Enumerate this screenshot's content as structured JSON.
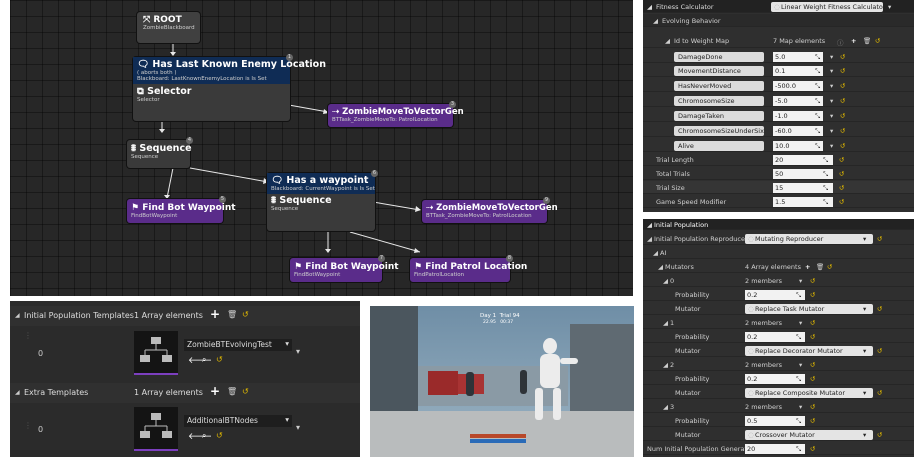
{
  "bt": {
    "root": {
      "title": "ROOT",
      "sub": "ZombieBlackboard"
    },
    "selector_node": {
      "deco_title": "Has Last Known Enemy Location",
      "deco_l1": "( aborts both )",
      "deco_l2": "Blackboard: LastKnownEnemyLocation is Is Set",
      "title": "Selector",
      "sub": "Selector",
      "pin": "1"
    },
    "move1": {
      "title": "ZombieMoveToVectorGen",
      "sub": "BTTask_ZombieMoveTo: PatrolLocation",
      "pin": "3"
    },
    "sequence1": {
      "title": "Sequence",
      "sub": "Sequence",
      "pin": "4"
    },
    "find1": {
      "title": "Find Bot Waypoint",
      "sub": "FindBotWaypoint",
      "pin": "5"
    },
    "sequence2": {
      "deco_title": "Has a waypoint",
      "deco_l1": "Blackboard: CurrentWaypoint is Is Set",
      "title": "Sequence",
      "sub": "Sequence",
      "pin": "6"
    },
    "move2": {
      "title": "ZombieMoveToVectorGen",
      "sub": "BTTask_ZombieMoveTo: PatrolLocation",
      "pin": "9"
    },
    "find2": {
      "title": "Find Bot Waypoint",
      "sub": "FindBotWaypoint",
      "pin": "7"
    },
    "find3": {
      "title": "Find Patrol Location",
      "sub": "FindPatrolLocation",
      "pin": "8"
    },
    "pin_sel_small": "1",
    "pin_move1_small": "3"
  },
  "fitness": {
    "label": "Fitness Calculator",
    "value": "Linear Weight Fitness Calculator",
    "evolving": "Evolving Behavior",
    "map_label": "Id to Weight Map",
    "map_count": "7 Map elements",
    "entries": [
      {
        "key": "DamageDone",
        "val": "5.0"
      },
      {
        "key": "MovementDistance",
        "val": "0.1"
      },
      {
        "key": "HasNeverMoved",
        "val": "-500.0"
      },
      {
        "key": "ChromosomeSize",
        "val": "-5.0"
      },
      {
        "key": "DamageTaken",
        "val": "-1.0"
      },
      {
        "key": "ChromosomeSizeUnderSix",
        "val": "-60.0"
      },
      {
        "key": "Alive",
        "val": "10.0"
      }
    ],
    "params": [
      {
        "label": "Trial Length",
        "val": "20"
      },
      {
        "label": "Total Trials",
        "val": "50"
      },
      {
        "label": "Trial Size",
        "val": "15"
      },
      {
        "label": "Game Speed Modifier",
        "val": "1.5"
      }
    ]
  },
  "population": {
    "header": "Initial Population",
    "repro_label": "Initial Population Reproducer",
    "repro_val": "Mutating Reproducer",
    "ai": "AI",
    "mutators_label": "Mutators",
    "mutators_count": "4 Array elements",
    "items": [
      {
        "idx": "0",
        "members": "2 members",
        "prob": "0.2",
        "mutator": "Replace Task Mutator"
      },
      {
        "idx": "1",
        "members": "2 members",
        "prob": "0.2",
        "mutator": "Replace Decorator Mutator"
      },
      {
        "idx": "2",
        "members": "2 members",
        "prob": "0.2",
        "mutator": "Replace Composite Mutator"
      },
      {
        "idx": "3",
        "members": "2 members",
        "prob": "0.5",
        "mutator": "Crossover Mutator"
      }
    ],
    "prob_label": "Probability",
    "mutator_label": "Mutator",
    "num_label": "Num Initial Population Generatio",
    "num_val": "20"
  },
  "templates": {
    "t1_label": "Initial Population Templates",
    "t1_count": "1 Array elements",
    "t1_idx": "0",
    "t1_val": "ZombieBTEvolvingTest",
    "t2_label": "Extra Templates",
    "t2_count": "1 Array elements",
    "t2_idx": "0",
    "t2_val": "AdditionalBTNodes"
  },
  "game": {
    "day": "Day 1",
    "trial": "Trial 94",
    "t1": "22.95",
    "t2": "00:37"
  },
  "colors": {
    "accent": "#e0b800",
    "task": "#5a2c8a",
    "decorator": "#0f2c55"
  }
}
